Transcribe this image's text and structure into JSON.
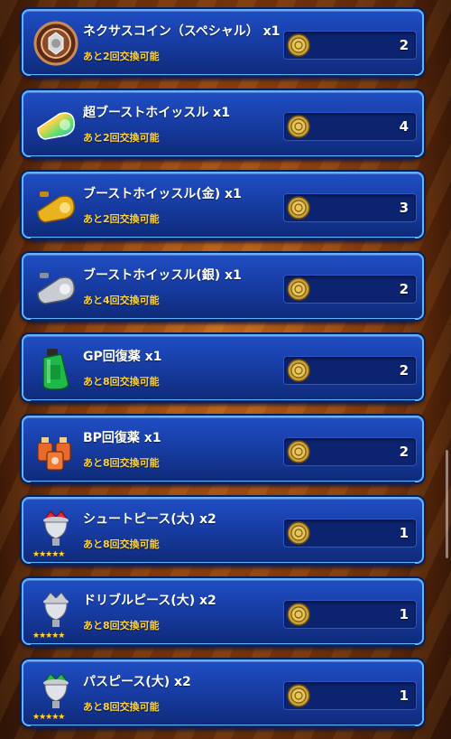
{
  "items": [
    {
      "name": "ネクサスコイン（スペシャル） x1",
      "remaining": "あと2回交換可能",
      "cost": "2",
      "icon": "nexus-coin-icon"
    },
    {
      "name": "超ブーストホイッスル x1",
      "remaining": "あと2回交換可能",
      "cost": "4",
      "icon": "super-boost-whistle-icon"
    },
    {
      "name": "ブーストホイッスル(金) x1",
      "remaining": "あと2回交換可能",
      "cost": "3",
      "icon": "gold-whistle-icon"
    },
    {
      "name": "ブーストホイッスル(銀) x1",
      "remaining": "あと4回交換可能",
      "cost": "2",
      "icon": "silver-whistle-icon"
    },
    {
      "name": "GP回復薬 x1",
      "remaining": "あと8回交換可能",
      "cost": "2",
      "icon": "gp-potion-icon"
    },
    {
      "name": "BP回復薬 x1",
      "remaining": "あと8回交換可能",
      "cost": "2",
      "icon": "bp-potion-icon"
    },
    {
      "name": "シュートピース(大) x2",
      "remaining": "あと8回交換可能",
      "cost": "1",
      "icon": "shoot-piece-icon",
      "stars": "★★★★★"
    },
    {
      "name": "ドリブルピース(大) x2",
      "remaining": "あと8回交換可能",
      "cost": "1",
      "icon": "dribble-piece-icon",
      "stars": "★★★★★"
    },
    {
      "name": "パスピース(大) x2",
      "remaining": "あと8回交換可能",
      "cost": "1",
      "icon": "pass-piece-icon",
      "stars": "★★★★★"
    }
  ],
  "currency_icon": "medal-coin-icon",
  "colors": {
    "accent": "#ffd23a",
    "panel": "#1a47b8",
    "border": "#5bb6ff"
  }
}
